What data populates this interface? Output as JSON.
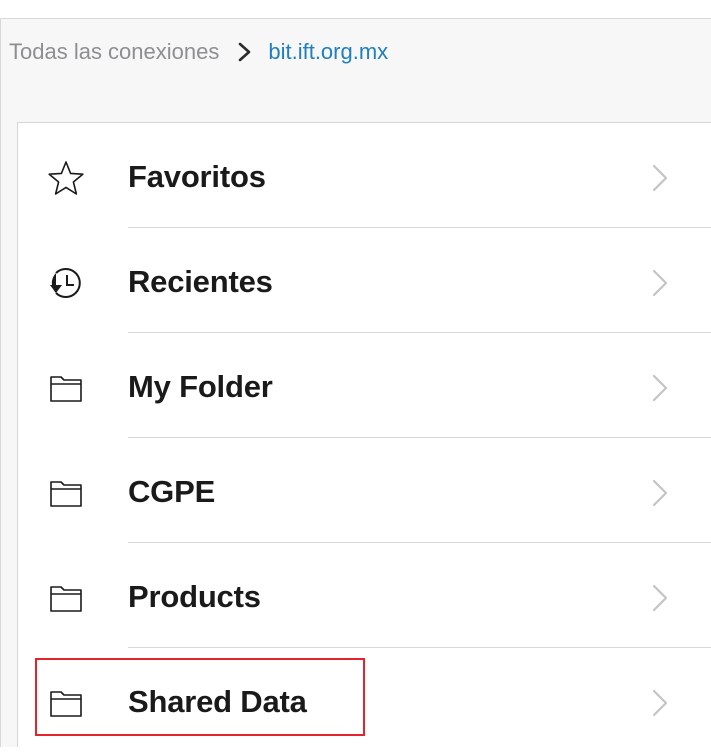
{
  "breadcrumb": {
    "root": "Todas las conexiones",
    "current": "bit.ift.org.mx"
  },
  "items": [
    {
      "label": "Favoritos",
      "icon": "star-icon"
    },
    {
      "label": "Recientes",
      "icon": "clock-history-icon"
    },
    {
      "label": "My Folder",
      "icon": "folder-icon"
    },
    {
      "label": "CGPE",
      "icon": "folder-icon"
    },
    {
      "label": "Products",
      "icon": "folder-icon"
    },
    {
      "label": "Shared Data",
      "icon": "folder-icon"
    }
  ],
  "colors": {
    "link": "#1f7fc1",
    "highlight_border": "#e3242b"
  }
}
